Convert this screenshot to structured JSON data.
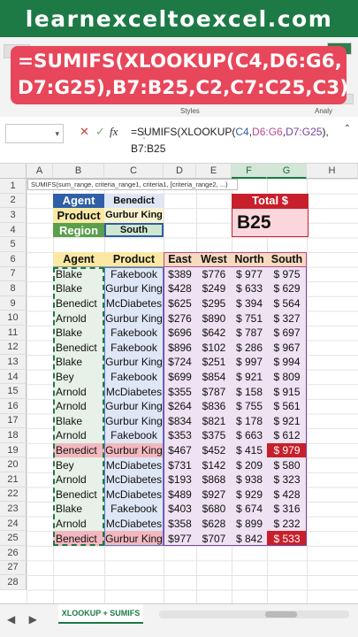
{
  "banner": "learnexceltoexcel.com",
  "overlay": {
    "line1": "=SUMIFS(XLOOKUP(C4,D6:G6,",
    "line2": "D7:G25),B7:B25,C2,C7:C25,C3)"
  },
  "ribbon": {
    "styles_group": "Styles",
    "analyze_group": "Analy"
  },
  "formula_bar": {
    "namebox_value": "",
    "fx": "fx",
    "line1": [
      "=SUMIFS(XLOOKUP(",
      "C4",
      ",",
      "D6:G6",
      ",",
      "D7:G25",
      "),"
    ],
    "line2": "B7:B25"
  },
  "tooltip": "SUMIFS(sum_range, criteria_range1, criteria1, [criteria_range2, ...)",
  "columns": [
    "A",
    "B",
    "C",
    "D",
    "E",
    "F",
    "G",
    "H"
  ],
  "rows": [
    "1",
    "2",
    "3",
    "4",
    "5",
    "6",
    "7",
    "8",
    "9",
    "10",
    "11",
    "12",
    "13",
    "14",
    "15",
    "16",
    "17",
    "18",
    "19",
    "20",
    "21",
    "22",
    "23",
    "24",
    "25",
    "26",
    "27",
    "28"
  ],
  "lookup": {
    "agent_label": "Agent",
    "agent_value": "Benedict",
    "product_label": "Product",
    "product_value": "Gurbur King",
    "region_label": "Region",
    "region_value": "South",
    "total_label": "Total $",
    "total_value": "B25"
  },
  "table": {
    "headers": [
      "Agent",
      "Product",
      "East",
      "West",
      "North",
      "South"
    ],
    "rows": [
      [
        "Blake",
        "Fakebook",
        "$389",
        "$776",
        "$ 977",
        "$ 975"
      ],
      [
        "Blake",
        "Gurbur King",
        "$428",
        "$249",
        "$ 633",
        "$ 629"
      ],
      [
        "Benedict",
        "McDiabetes",
        "$625",
        "$295",
        "$ 394",
        "$ 564"
      ],
      [
        "Arnold",
        "Gurbur King",
        "$276",
        "$890",
        "$ 751",
        "$ 327"
      ],
      [
        "Blake",
        "Fakebook",
        "$696",
        "$642",
        "$ 787",
        "$ 697"
      ],
      [
        "Benedict",
        "Fakebook",
        "$896",
        "$102",
        "$ 286",
        "$ 967"
      ],
      [
        "Blake",
        "Gurbur King",
        "$724",
        "$251",
        "$ 997",
        "$ 994"
      ],
      [
        "Bey",
        "Fakebook",
        "$699",
        "$854",
        "$ 921",
        "$ 809"
      ],
      [
        "Arnold",
        "McDiabetes",
        "$355",
        "$787",
        "$ 158",
        "$ 915"
      ],
      [
        "Arnold",
        "Gurbur King",
        "$264",
        "$836",
        "$ 755",
        "$ 561"
      ],
      [
        "Blake",
        "Gurbur King",
        "$834",
        "$821",
        "$ 178",
        "$ 921"
      ],
      [
        "Arnold",
        "Fakebook",
        "$353",
        "$375",
        "$ 663",
        "$ 612"
      ],
      [
        "Benedict",
        "Gurbur King",
        "$467",
        "$452",
        "$ 415",
        "$ 979"
      ],
      [
        "Bey",
        "McDiabetes",
        "$731",
        "$142",
        "$ 209",
        "$ 580"
      ],
      [
        "Arnold",
        "McDiabetes",
        "$193",
        "$868",
        "$ 938",
        "$ 323"
      ],
      [
        "Benedict",
        "McDiabetes",
        "$489",
        "$927",
        "$ 929",
        "$ 428"
      ],
      [
        "Blake",
        "Fakebook",
        "$403",
        "$680",
        "$ 674",
        "$ 316"
      ],
      [
        "Arnold",
        "McDiabetes",
        "$358",
        "$628",
        "$ 899",
        "$ 232"
      ],
      [
        "Benedict",
        "Gurbur King",
        "$977",
        "$707",
        "$ 842",
        "$ 533"
      ]
    ],
    "highlight_rows": [
      12,
      18
    ]
  },
  "sheet_tab": "XLOOKUP + SUMIFS",
  "colors": {
    "excel_green": "#1d7a45",
    "overlay_red": "#e8465a",
    "agent_blue": "#2e5fa8",
    "product_yellow": "#fbe9a3",
    "region_green": "#5a9f4b",
    "total_red": "#c8202b",
    "total_pink": "#fbd7dd",
    "highlight_red": "#c8202b",
    "highlight_pink": "#f3b8be"
  }
}
